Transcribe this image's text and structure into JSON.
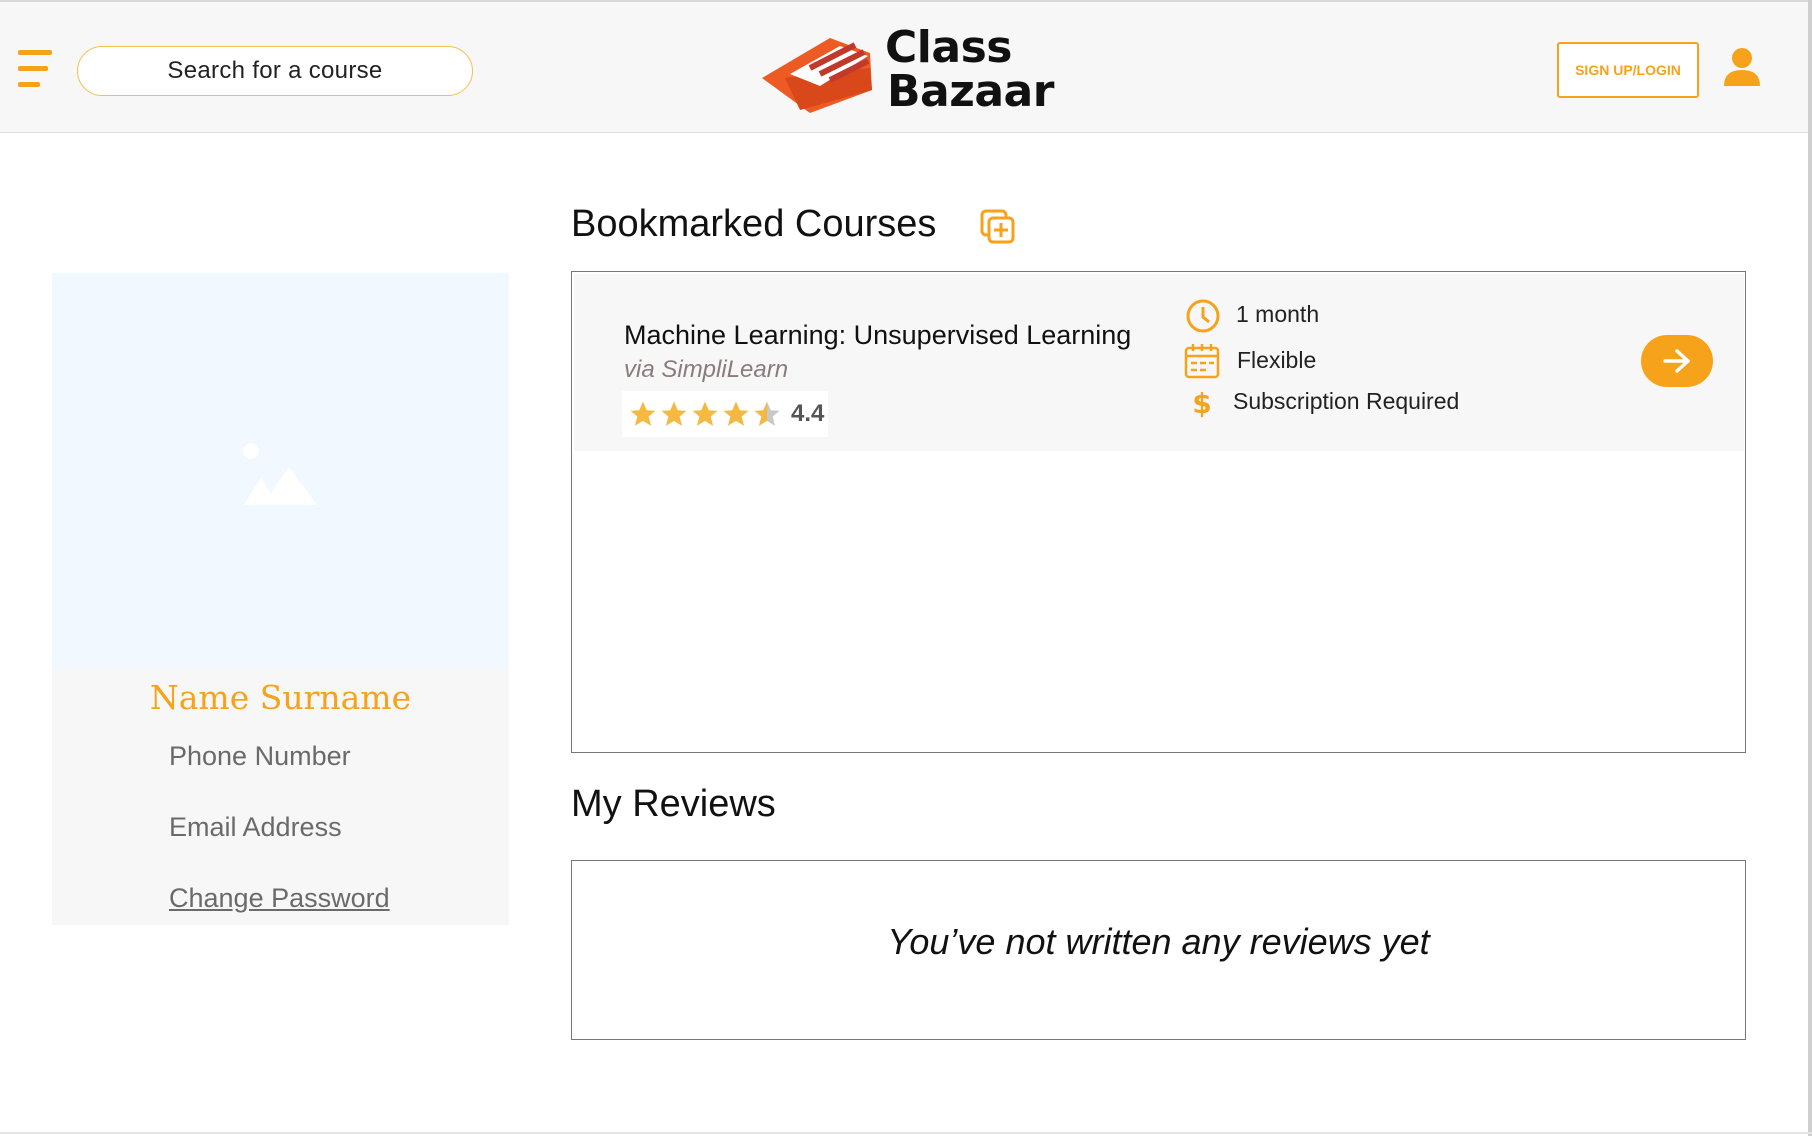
{
  "header": {
    "search_placeholder": "Search for a course",
    "logo_line1": "Class",
    "logo_line2": "Bazaar",
    "signup_label": "SIGN UP/LOGIN"
  },
  "profile": {
    "name": "Name Surname",
    "phone": "Phone Number",
    "email": "Email Address",
    "change_password": "Change Password"
  },
  "bookmarks": {
    "title": "Bookmarked Courses",
    "courses": [
      {
        "title": "Machine Learning: Unsupervised Learning",
        "provider": "via SimpliLearn",
        "rating": "4.4",
        "duration": "1 month",
        "schedule": "Flexible",
        "price": "Subscription Required"
      }
    ]
  },
  "reviews": {
    "title": "My Reviews",
    "empty_message": "You’ve not written any reviews yet"
  },
  "colors": {
    "accent": "#f7a21b",
    "logo_orange": "#ee5a24",
    "logo_red": "#c0392b"
  }
}
